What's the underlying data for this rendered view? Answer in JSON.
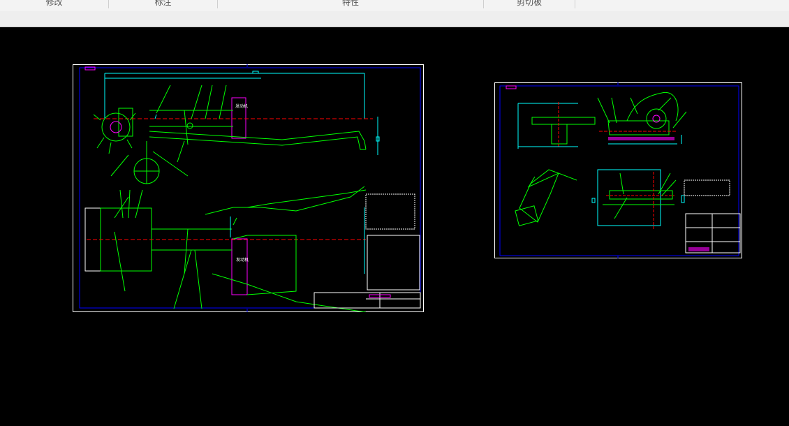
{
  "ribbon": {
    "groups": [
      {
        "label": "修改"
      },
      {
        "label": "标注"
      },
      {
        "label": "特性"
      },
      {
        "label": "剪切板"
      }
    ]
  },
  "drawing": {
    "sheet1": {
      "text_boxes": [
        "发动机",
        "发动机"
      ]
    }
  },
  "colors": {
    "background": "#000000",
    "frame": "#ffffff",
    "geometry": "#00ff00",
    "dimension": "#00ffff",
    "centerline": "#ff0000",
    "highlight": "#ff00ff",
    "border": "#0000ff"
  }
}
